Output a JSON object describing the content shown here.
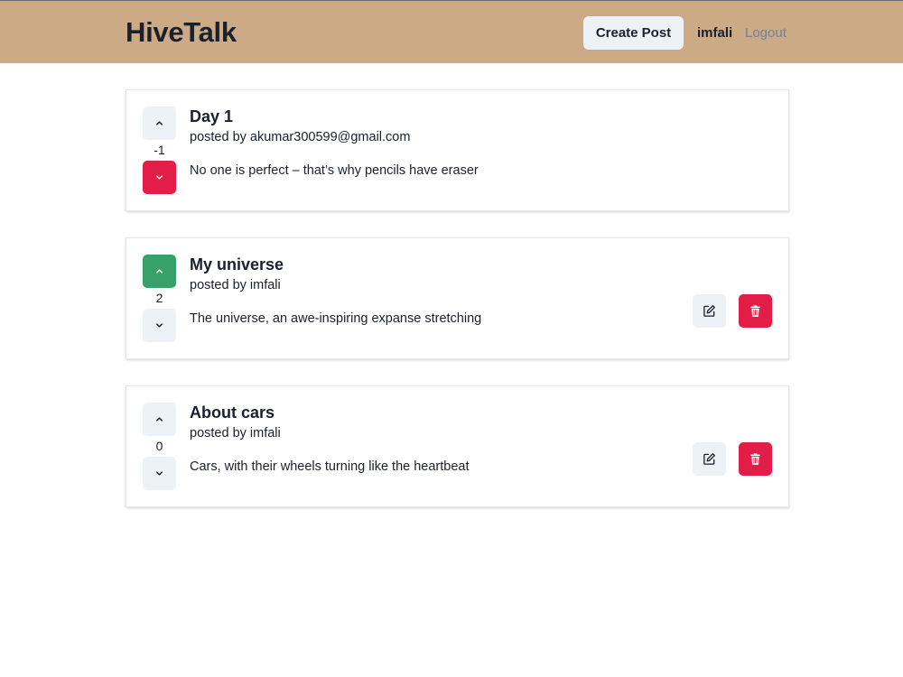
{
  "header": {
    "brand": "HiveTalk",
    "create_post_label": "Create Post",
    "username": "imfali",
    "logout_label": "Logout",
    "background_color": "#cdaa86"
  },
  "posts": [
    {
      "title": "Day 1",
      "byline": "posted by akumar300599@gmail.com",
      "body": "No one is perfect – that’s why pencils have eraser",
      "score": "-1",
      "user_vote": "down",
      "owned_by_current_user": false
    },
    {
      "title": "My universe",
      "byline": "posted by imfali",
      "body": "The universe, an awe-inspiring expanse stretching",
      "score": "2",
      "user_vote": "up",
      "owned_by_current_user": true
    },
    {
      "title": "About cars",
      "byline": "posted by imfali",
      "body": "Cars, with their wheels turning like the heartbeat",
      "score": "0",
      "user_vote": "none",
      "owned_by_current_user": true
    }
  ],
  "icons": {
    "upvote": "chevron-up-icon",
    "downvote": "chevron-down-icon",
    "edit": "edit-icon",
    "delete": "trash-icon"
  },
  "colors": {
    "upvote_active": "#38a169",
    "downvote_active": "#e11d48",
    "delete_button": "#e11d48",
    "neutral_button": "#edf2f7"
  }
}
